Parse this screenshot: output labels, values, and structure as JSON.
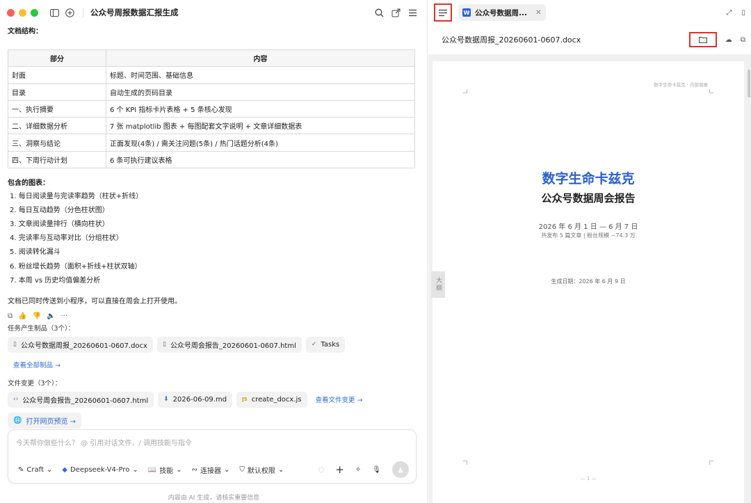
{
  "window": {
    "title": "公众号周报数据汇报生成",
    "traffic_lights": [
      "#ff5f57",
      "#febc2e",
      "#28c840"
    ]
  },
  "message": {
    "doc_structure_label": "文档结构：",
    "table": {
      "headers": [
        "部分",
        "内容"
      ],
      "rows": [
        [
          "封面",
          "标题、时间范围、基础信息"
        ],
        [
          "目录",
          "自动生成的页码目录"
        ],
        [
          "一、执行摘要",
          "6 个 KPI 指标卡片表格 + 5 条核心发现"
        ],
        [
          "二、详细数据分析",
          "7 张 matplotlib 图表 + 每图配套文字说明 + 文章详细数据表"
        ],
        [
          "三、洞察与结论",
          "正面发现(4条) / 需关注问题(5条) / 热门话题分析(4条)"
        ],
        [
          "四、下周行动计划",
          "6 条可执行建议表格"
        ]
      ]
    },
    "charts_label": "包含的图表：",
    "charts": [
      "1. 每日阅读量与完读率趋势（柱状+折线）",
      "2. 每日互动趋势（分色柱状图）",
      "3. 文章阅读量排行（横向柱状）",
      "4. 完读率与互动率对比（分组柱状）",
      "5. 阅读转化漏斗",
      "6. 粉丝增长趋势（面积+折线+柱状双轴）",
      "7. 本周 vs 历史均值偏差分析"
    ],
    "note": "文档已同时传送到小程序，可以直接在周会上打开使用。"
  },
  "artifacts": {
    "label": "任务产生制品（3个）：",
    "items": [
      {
        "name": "公众号数据周报_20260601-0607.docx",
        "icon": "file-icon"
      },
      {
        "name": "公众号周会报告_20260601-0607.html",
        "icon": "file-icon"
      },
      {
        "name": "Tasks",
        "icon": "check-circle-icon"
      }
    ],
    "view_all": "查看全部制品 →"
  },
  "file_changes": {
    "label": "文件变更（3个）：",
    "items": [
      {
        "name": "公众号周会报告_20260601-0607.html",
        "icon": "code-icon"
      },
      {
        "name": "2026-06-09.md",
        "icon": "markdown-icon"
      },
      {
        "name": "create_docx.js",
        "icon": "js-icon"
      }
    ],
    "view_changes": "查看文件变更 →",
    "preview": "打开网页预览 →"
  },
  "input": {
    "placeholder": "今天帮你做些什么？  @ 引用对话文件，/ 调用技能与指令",
    "mode": "Craft",
    "model": "Deepseek-V4-Pro",
    "skills": "技能",
    "connectors": "连接器",
    "permissions": "默认权限"
  },
  "footer_note": "内容由 AI 生成，请核实重要信息",
  "right_pane": {
    "tab_title": "公众号数据周...",
    "doc_filename": "公众号数据周报_20260601-0607.docx",
    "outline_label": "大纲",
    "highlight_color": "#e0302a",
    "document": {
      "header_tag": "数字生命卡兹克 · 内部周报",
      "title": "数字生命卡兹克",
      "subtitle": "公众号数据周会报告",
      "date_range": "2026 年 6 月 1 日 — 6 月 7 日",
      "meta": "共发布 5 篇文章 | 粉丝规模 ~74.3 万",
      "generated": "生成日期：2026 年 6 月 9 日",
      "page_number": "— 1 —",
      "title_color": "#2a5fcf"
    }
  }
}
